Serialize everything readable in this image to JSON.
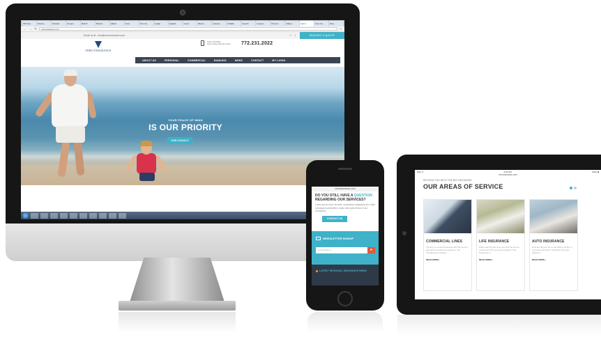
{
  "colors": {
    "accent": "#3fb2c9",
    "nav_dark": "#3a4452",
    "brand_navy": "#234a7a"
  },
  "desktop": {
    "browser_tabs": [
      "MN Insu",
      "Premiu",
      "Tactical",
      "Groupo",
      "Mail fil",
      "Photos",
      "Allstat",
      "Insur",
      "Prot Ins",
      "Leadp",
      "Capital",
      "Insurl",
      "Bisom",
      "Insuran",
      "PinkRe",
      "Search",
      "Invesco",
      "Prot Ins",
      "Villeen",
      "Vero I",
      "Vero Ins",
      "Rely"
    ],
    "address_bar": "veroinsurance.com",
    "topbar_contact": "Email us at : info@veroinsurance.com",
    "topbar_social": [
      "f",
      "t"
    ],
    "quote_button": "REQUEST A QUOTE",
    "logo_text": "VERO INSURANCE",
    "phone_line1": "CALL US NOW",
    "phone_line2": "Get a quote discount quote",
    "phone_number": "772.231.2022",
    "nav_items": [
      "ABOUT US",
      "PERSONAL",
      "COMMERCIAL",
      "BANKING",
      "NEWS",
      "CONTACT",
      "MY LOGIN"
    ],
    "hero_pretitle": "YOUR PEACE OF MIND",
    "hero_title": "IS OUR PRIORITY",
    "hero_button": "OUR LEGACY",
    "taskbar_icons": [
      "explorer-icon",
      "ie-icon",
      "media-icon",
      "folder-icon",
      "chrome-icon",
      "firefox-icon",
      "skype-icon",
      "word-icon",
      "excel-icon",
      "outlook-icon"
    ]
  },
  "phone": {
    "url": "veroinsurance.com",
    "question_line1": "DO YOU STILL HAVE A",
    "question_highlight": "QUESTION",
    "question_line2": "REGARDING OUR SERVICES?",
    "body_text": "Lorem ipsum dolor sit amet, consectetur adipiscing elit. Nulla consequat consectetur ornare duis porta lectus et dui consequat.",
    "contact_button": "CONTACT US",
    "newsletter_title": "NEWSLETTER SIGNUP",
    "newsletter_placeholder": "Email Address",
    "send_icon": "send-arrow",
    "latest_news": "LATEST REGIONAL INSURANCE NEWS"
  },
  "tablet": {
    "status_left": "iPad ᯤ",
    "status_time": "4:51 PM",
    "status_right": "100% ▮",
    "url": "veroinsurance.com",
    "pretitle": "HELPING YOU WITH THE BIG DECISIONS",
    "title": "OUR AREAS OF SERVICE",
    "cards": [
      {
        "title": "COMMERCIAL LINES",
        "text": "The key to a robust business that has proven approach to business insurance, risk management includes ...",
        "link": "READ MORE ›"
      },
      {
        "title": "LIFE INSURANCE",
        "text": "When was the last time you took the time to review your life insurance program? Life insurance is ...",
        "link": "READ MORE ›"
      },
      {
        "title": "AUTO INSURANCE",
        "text": "How are all your tire to pay $60 a month on your auto insurance? Resisting the been valued to ...",
        "link": "READ MORE ›"
      }
    ]
  }
}
